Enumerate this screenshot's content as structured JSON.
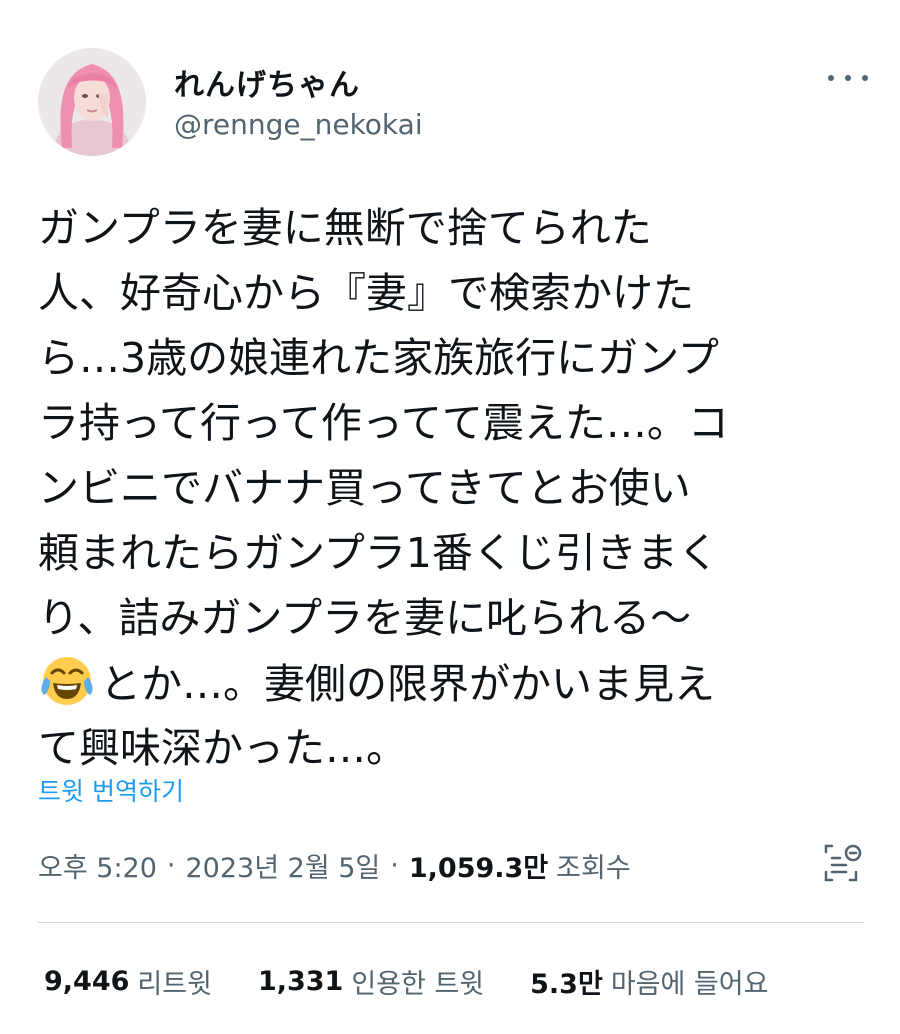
{
  "user": {
    "display_name": "れんげちゃん",
    "handle": "@rennge_nekokai",
    "avatar_icon": "profile-photo-pink-hair"
  },
  "menu": {
    "icon": "more-horizontal-icon"
  },
  "tweet": {
    "lines": [
      "ガンプラを妻に無断で捨てられた",
      "人、好奇心から『妻』で検索かけた",
      "ら…3歳の娘連れた家族旅行にガンプ",
      "ラ持って行って作ってて震えた…。コ",
      "ンビニでバナナ買ってきてとお使い",
      "頼まれたらガンプラ1番くじ引きまく",
      "り、詰みガンプラを妻に叱られる〜",
      "とか…。妻側の限界がかいま見え",
      "て興味深かった…。"
    ],
    "emoji_icon": "face-with-tears-of-joy-emoji"
  },
  "translate_label": "트윗 번역하기",
  "meta": {
    "time": "오후 5:20",
    "separator": "·",
    "date": "2023년 2월 5일",
    "views_count": "1,059.3만",
    "views_label": "조회수",
    "analytics_icon": "analytics-icon"
  },
  "stats": {
    "retweets_count": "9,446",
    "retweets_label": "리트윗",
    "quotes_count": "1,331",
    "quotes_label": "인용한 트윗",
    "likes_count": "5.3만",
    "likes_label": "마음에 들어요"
  },
  "colors": {
    "text": "#0f1419",
    "secondary": "#536471",
    "link": "#1d9bf0",
    "divider": "#cfd9de"
  }
}
